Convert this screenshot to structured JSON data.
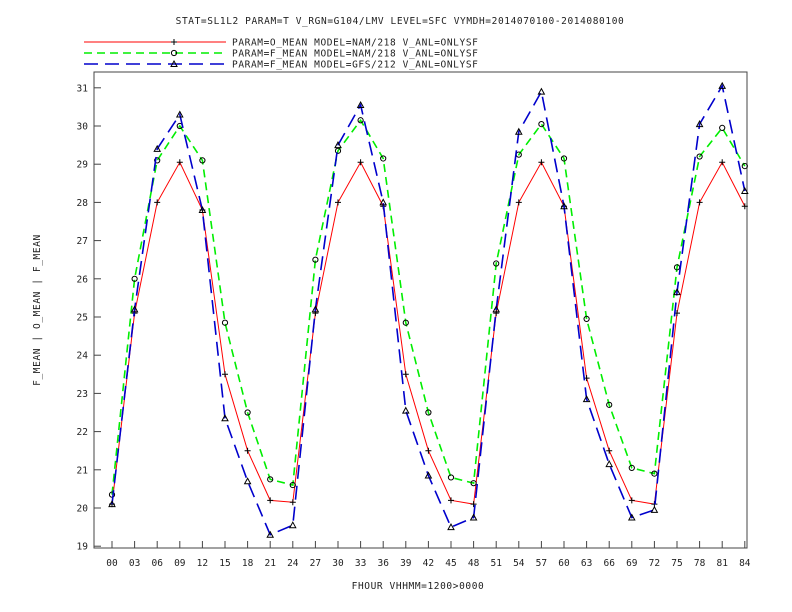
{
  "header": {
    "title": "STAT=SL1L2 PARAM=T V_RGN=G104/LMV LEVEL=SFC VYMDH=2014070100-2014080100"
  },
  "legend": [
    {
      "label": "PARAM=O_MEAN MODEL=NAM/218 V_ANL=ONLYSF",
      "marker": "+",
      "color": "#ff0000",
      "dash": "solid"
    },
    {
      "label": "PARAM=F_MEAN MODEL=NAM/218 V_ANL=ONLYSF",
      "marker": "◇",
      "color": "#00ee00",
      "dash": "dashed"
    },
    {
      "label": "PARAM=F_MEAN MODEL=GFS/212 V_ANL=ONLYSF",
      "marker": "△",
      "color": "#0000cc",
      "dash": "longdash"
    }
  ],
  "chart_data": {
    "type": "line",
    "title": "STAT=SL1L2 PARAM=T V_RGN=G104/LMV LEVEL=SFC VYMDH=2014070100-2014080100",
    "xlabel": "FHOUR VHHMM=1200>0000",
    "ylabel": "F_MEAN | O_MEAN | F_MEAN",
    "categories": [
      "00",
      "03",
      "06",
      "09",
      "12",
      "15",
      "18",
      "21",
      "24",
      "27",
      "30",
      "33",
      "36",
      "39",
      "42",
      "45",
      "48",
      "51",
      "54",
      "57",
      "60",
      "63",
      "66",
      "69",
      "72",
      "75",
      "78",
      "81",
      "84"
    ],
    "yticks": [
      "19",
      "20",
      "21",
      "22",
      "23",
      "24",
      "25",
      "26",
      "27",
      "28",
      "29",
      "30",
      "31"
    ],
    "ylim": [
      18.9,
      31.5
    ],
    "grid": false,
    "legend_position": "top-left",
    "series": [
      {
        "name": "PARAM=O_MEAN MODEL=NAM/218 V_ANL=ONLYSF",
        "color": "#ff0000",
        "values": [
          20.1,
          25.1,
          28.0,
          29.05,
          27.8,
          23.5,
          21.5,
          20.2,
          20.15,
          25.1,
          28.0,
          29.05,
          27.9,
          23.5,
          21.5,
          20.2,
          20.1,
          25.1,
          28.0,
          29.05,
          27.9,
          23.4,
          21.5,
          20.2,
          20.1,
          25.1,
          28.0,
          29.05,
          27.9
        ]
      },
      {
        "name": "PARAM=F_MEAN MODEL=NAM/218 V_ANL=ONLYSF",
        "color": "#00ee00",
        "values": [
          20.35,
          26.0,
          29.1,
          30.0,
          29.1,
          24.85,
          22.5,
          20.75,
          20.6,
          26.5,
          29.35,
          30.15,
          29.15,
          24.85,
          22.5,
          20.8,
          20.65,
          26.4,
          29.25,
          30.05,
          29.15,
          24.95,
          22.7,
          21.05,
          20.9,
          26.3,
          29.2,
          29.95,
          28.95
        ]
      },
      {
        "name": "PARAM=F_MEAN MODEL=GFS/212 V_ANL=ONLYSF",
        "color": "#0000cc",
        "values": [
          20.1,
          25.2,
          29.4,
          30.3,
          27.8,
          22.35,
          20.7,
          19.3,
          19.55,
          25.2,
          29.5,
          30.55,
          28.0,
          22.55,
          20.85,
          19.5,
          19.75,
          25.2,
          29.85,
          30.9,
          27.9,
          22.85,
          21.15,
          19.75,
          19.95,
          25.65,
          30.05,
          31.05,
          28.3
        ]
      }
    ]
  }
}
